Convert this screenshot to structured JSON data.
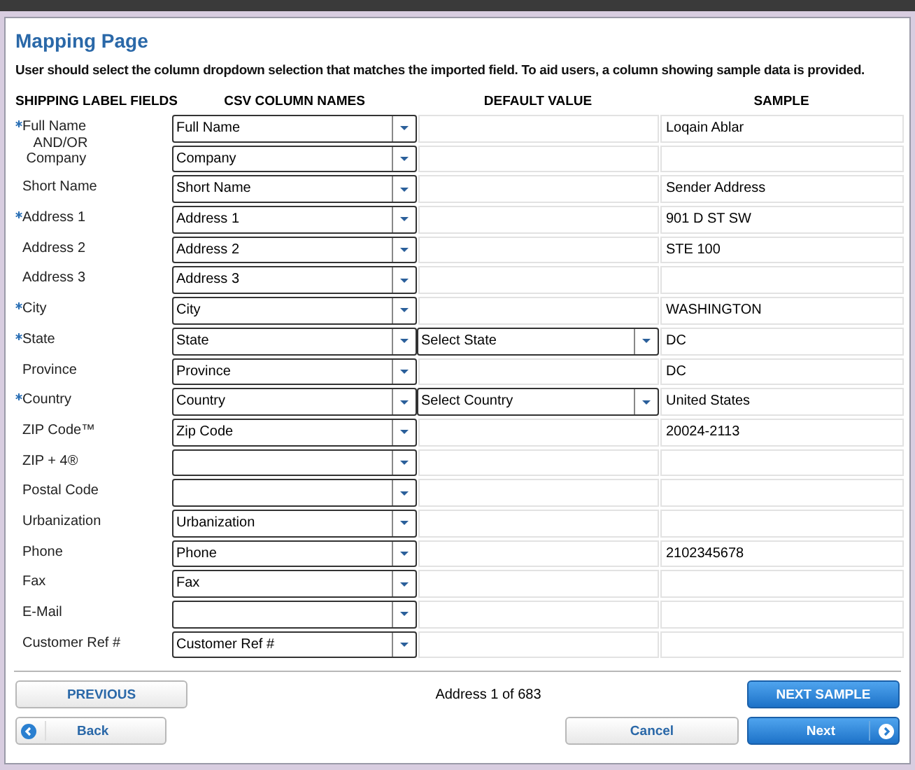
{
  "title": "Mapping Page",
  "instructions": "User should select the column dropdown selection that matches the imported field.  To aid users, a column showing sample data is provided.",
  "columns": [
    "SHIPPING LABEL FIELDS",
    "CSV COLUMN NAMES",
    "DEFAULT VALUE",
    "SAMPLE"
  ],
  "fields": [
    {
      "label": "Full Name\n   AND/OR\n Company",
      "required": true,
      "rows": [
        {
          "csv": "Full Name",
          "sample": "Loqain Ablar"
        },
        {
          "csv": "Company",
          "sample": ""
        }
      ]
    },
    {
      "label": "Short Name",
      "required": false,
      "rows": [
        {
          "csv": "Short Name",
          "sample": "Sender Address"
        }
      ]
    },
    {
      "label": "Address 1",
      "required": true,
      "rows": [
        {
          "csv": "Address 1",
          "sample": "901 D ST SW"
        }
      ]
    },
    {
      "label": "Address 2",
      "required": false,
      "rows": [
        {
          "csv": "Address 2",
          "sample": "STE 100"
        }
      ]
    },
    {
      "label": "Address 3",
      "required": false,
      "rows": [
        {
          "csv": "Address 3",
          "sample": ""
        }
      ]
    },
    {
      "label": "City",
      "required": true,
      "rows": [
        {
          "csv": "City",
          "sample": "WASHINGTON"
        }
      ]
    },
    {
      "label": "State",
      "required": true,
      "rows": [
        {
          "csv": "State",
          "default": {
            "kind": "select",
            "value": "Select State"
          },
          "sample": "DC"
        }
      ]
    },
    {
      "label": "Province",
      "required": false,
      "rows": [
        {
          "csv": "Province",
          "sample": "DC"
        }
      ]
    },
    {
      "label": "Country",
      "required": true,
      "rows": [
        {
          "csv": "Country",
          "default": {
            "kind": "select",
            "value": "Select Country"
          },
          "sample": "United States"
        }
      ]
    },
    {
      "label": "ZIP Code™",
      "required": false,
      "rows": [
        {
          "csv": "Zip Code",
          "sample": "20024-2113"
        }
      ]
    },
    {
      "label": "ZIP + 4®",
      "required": false,
      "rows": [
        {
          "csv": "",
          "sample": ""
        }
      ]
    },
    {
      "label": "Postal Code",
      "required": false,
      "rows": [
        {
          "csv": "",
          "sample": ""
        }
      ]
    },
    {
      "label": "Urbanization",
      "required": false,
      "rows": [
        {
          "csv": "Urbanization",
          "sample": ""
        }
      ]
    },
    {
      "label": "Phone",
      "required": false,
      "rows": [
        {
          "csv": "Phone",
          "sample": "2102345678"
        }
      ]
    },
    {
      "label": "Fax",
      "required": false,
      "rows": [
        {
          "csv": "Fax",
          "sample": ""
        }
      ]
    },
    {
      "label": "E-Mail",
      "required": false,
      "rows": [
        {
          "csv": "",
          "sample": ""
        }
      ]
    },
    {
      "label": "Customer Ref #",
      "required": false,
      "rows": [
        {
          "csv": "Customer Ref #",
          "sample": ""
        }
      ]
    }
  ],
  "pager": {
    "previous": "PREVIOUS",
    "status": "Address 1 of 683",
    "next": "NEXT SAMPLE"
  },
  "footer": {
    "back": "Back",
    "cancel": "Cancel",
    "next": "Next"
  }
}
